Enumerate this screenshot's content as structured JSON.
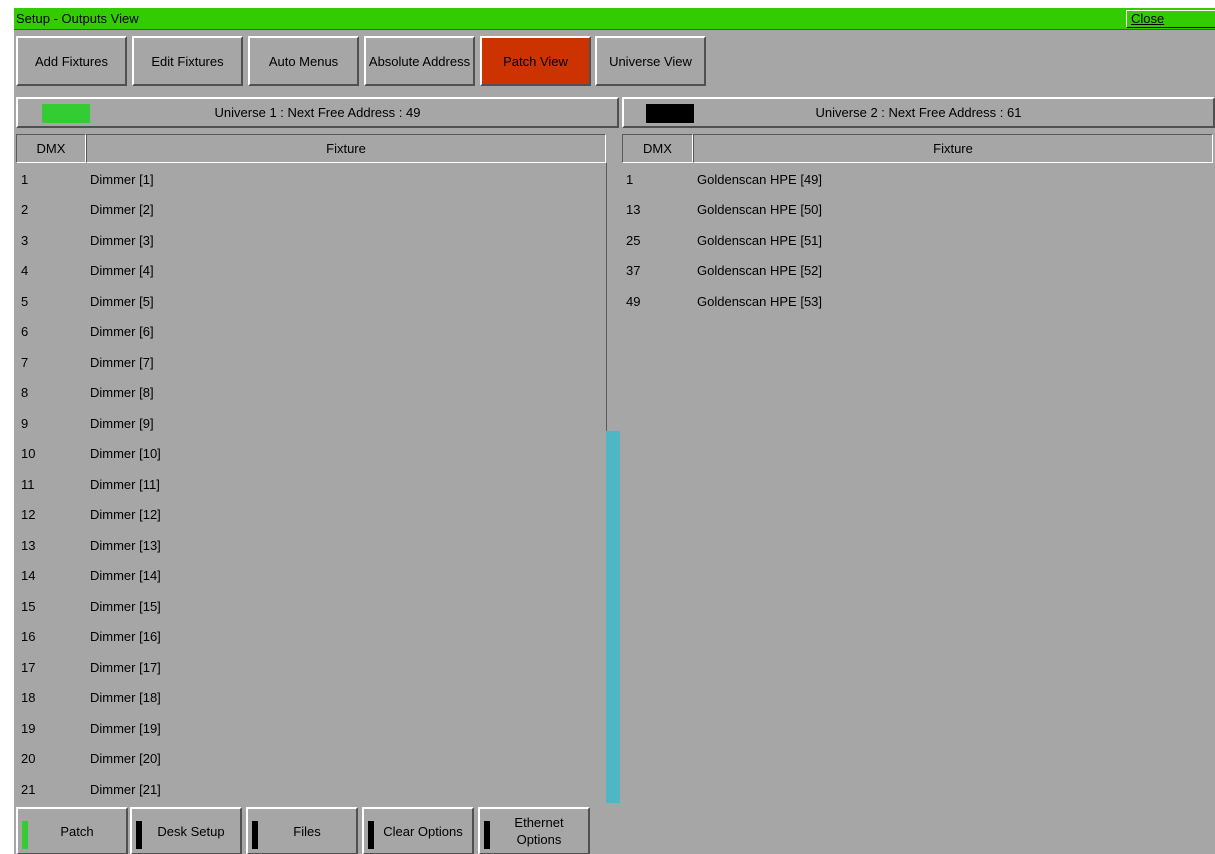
{
  "window": {
    "title": "Setup - Outputs View",
    "close_label": "Close"
  },
  "toolbar": {
    "add_fixtures": "Add Fixtures",
    "edit_fixtures": "Edit Fixtures",
    "auto_menus": "Auto Menus",
    "absolute_address": "Absolute Address",
    "patch_view": "Patch View",
    "universe_view": "Universe View",
    "active_color": "#cc3300"
  },
  "universe1": {
    "header": "Universe 1 : Next Free Address : 49",
    "swatch_color": "#33cc33",
    "col_dmx": "DMX",
    "col_fixture": "Fixture",
    "rows": [
      {
        "dmx": "1",
        "fixture": "Dimmer [1]"
      },
      {
        "dmx": "2",
        "fixture": "Dimmer [2]"
      },
      {
        "dmx": "3",
        "fixture": "Dimmer [3]"
      },
      {
        "dmx": "4",
        "fixture": "Dimmer [4]"
      },
      {
        "dmx": "5",
        "fixture": "Dimmer [5]"
      },
      {
        "dmx": "6",
        "fixture": "Dimmer [6]"
      },
      {
        "dmx": "7",
        "fixture": "Dimmer [7]"
      },
      {
        "dmx": "8",
        "fixture": "Dimmer [8]"
      },
      {
        "dmx": "9",
        "fixture": "Dimmer [9]"
      },
      {
        "dmx": "10",
        "fixture": "Dimmer [10]"
      },
      {
        "dmx": "11",
        "fixture": "Dimmer [11]"
      },
      {
        "dmx": "12",
        "fixture": "Dimmer [12]"
      },
      {
        "dmx": "13",
        "fixture": "Dimmer [13]"
      },
      {
        "dmx": "14",
        "fixture": "Dimmer [14]"
      },
      {
        "dmx": "15",
        "fixture": "Dimmer [15]"
      },
      {
        "dmx": "16",
        "fixture": "Dimmer [16]"
      },
      {
        "dmx": "17",
        "fixture": "Dimmer [17]"
      },
      {
        "dmx": "18",
        "fixture": "Dimmer [18]"
      },
      {
        "dmx": "19",
        "fixture": "Dimmer [19]"
      },
      {
        "dmx": "20",
        "fixture": "Dimmer [20]"
      },
      {
        "dmx": "21",
        "fixture": "Dimmer [21]"
      }
    ]
  },
  "universe2": {
    "header": "Universe 2 : Next Free Address : 61",
    "swatch_color": "#000000",
    "col_dmx": "DMX",
    "col_fixture": "Fixture",
    "rows": [
      {
        "dmx": "1",
        "fixture": "Goldenscan HPE [49]"
      },
      {
        "dmx": "13",
        "fixture": "Goldenscan HPE [50]"
      },
      {
        "dmx": "25",
        "fixture": "Goldenscan HPE [51]"
      },
      {
        "dmx": "37",
        "fixture": "Goldenscan HPE [52]"
      },
      {
        "dmx": "49",
        "fixture": "Goldenscan HPE [53]"
      }
    ]
  },
  "bottom_menu": [
    {
      "label": "Patch",
      "indicator_color": "#33cc33"
    },
    {
      "label": "Desk Setup",
      "indicator_color": "#000000"
    },
    {
      "label": "Files",
      "indicator_color": "#000000"
    },
    {
      "label": "Clear Options",
      "indicator_color": "#000000"
    },
    {
      "label": "Ethernet Options",
      "indicator_color": "#000000"
    }
  ],
  "colors": {
    "title_bar": "#33cc00",
    "background": "#a6a6a6",
    "scrollbar_thumb": "#4eb7c3"
  }
}
